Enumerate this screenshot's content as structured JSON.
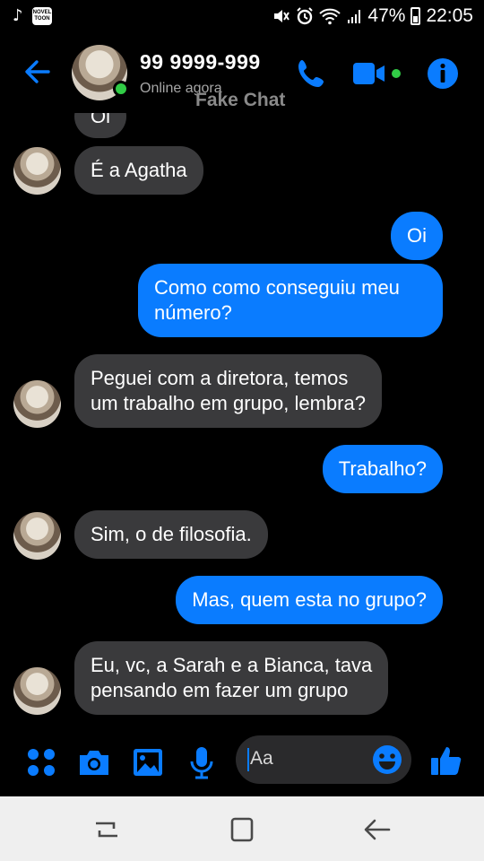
{
  "status_bar": {
    "battery": "47%",
    "time": "22:05",
    "app_icon_text": "NOVEL TOON"
  },
  "header": {
    "contact_name": "99 9999-999",
    "presence": "Online agora",
    "watermark": "Fake Chat"
  },
  "messages": [
    {
      "side": "in",
      "text": "Oi"
    },
    {
      "side": "in",
      "text": "É a Agatha"
    },
    {
      "side": "out",
      "text": "Oi"
    },
    {
      "side": "out",
      "text": "Como como conseguiu meu\nnúmero?"
    },
    {
      "side": "in",
      "text": "Peguei com a diretora, temos\num trabalho em grupo, lembra?"
    },
    {
      "side": "out",
      "text": "Trabalho?"
    },
    {
      "side": "in",
      "text": "Sim, o de filosofia."
    },
    {
      "side": "out",
      "text": "Mas, quem esta no grupo?"
    },
    {
      "side": "in",
      "text": "Eu, vc, a Sarah e a Bianca, tava\npensando em fazer um grupo"
    }
  ],
  "composer": {
    "placeholder": "Aa"
  },
  "colors": {
    "accent": "#0a7cff",
    "incoming_bubble": "#3a3a3c",
    "online": "#31cc46"
  },
  "icons": {
    "back": "back-arrow-icon",
    "call": "phone-icon",
    "video": "video-camera-icon",
    "info": "info-icon",
    "more": "four-dots-icon",
    "camera": "camera-icon",
    "gallery": "image-icon",
    "mic": "microphone-icon",
    "emoji": "emoji-icon",
    "like": "thumbs-up-icon"
  }
}
